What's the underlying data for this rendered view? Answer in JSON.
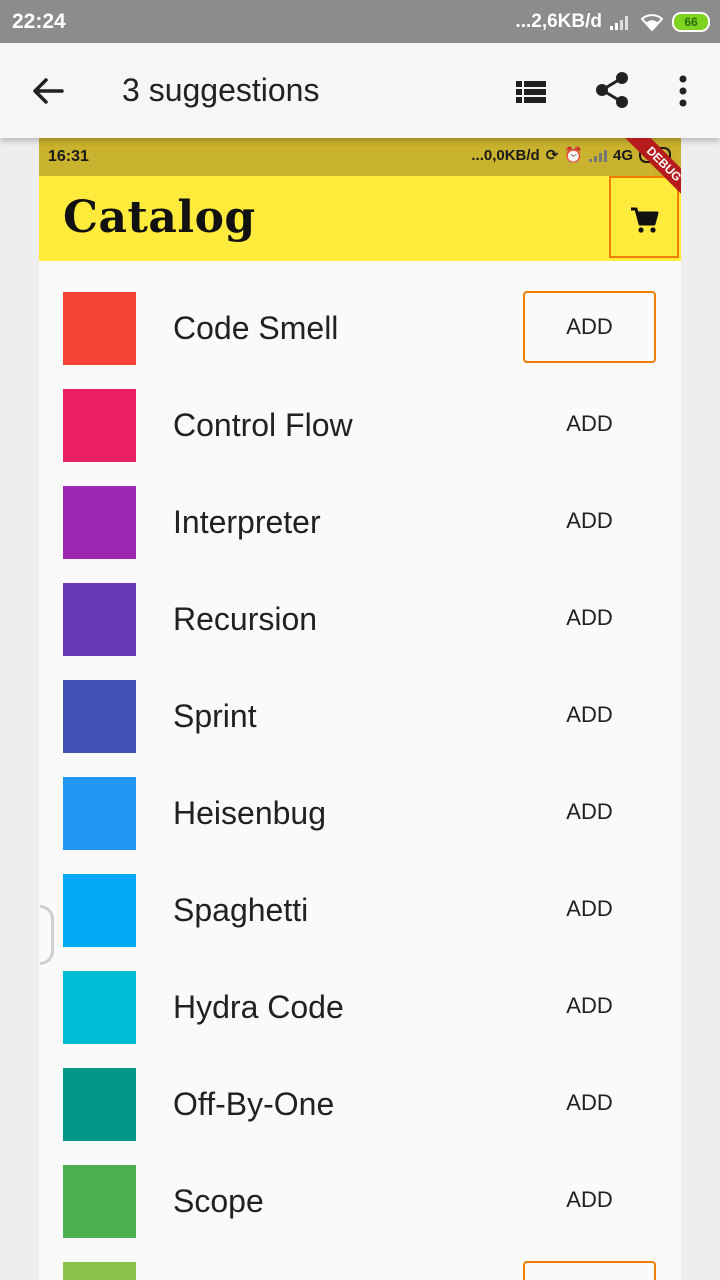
{
  "device_status": {
    "time": "22:24",
    "network": "...2,6KB/d",
    "battery": "66"
  },
  "appbar": {
    "title": "3 suggestions",
    "icons": [
      "back-arrow-icon",
      "list-view-icon",
      "share-icon",
      "more-vert-icon"
    ]
  },
  "app_status": {
    "time": "16:31",
    "network": "...0,0KB/d",
    "net_type": "4G",
    "battery": "69"
  },
  "catalog": {
    "title": "Catalog",
    "debug_banner": "DEBUG",
    "add_label": "ADD",
    "items": [
      {
        "name": "Code Smell",
        "color": "#f44336"
      },
      {
        "name": "Control Flow",
        "color": "#e91e63"
      },
      {
        "name": "Interpreter",
        "color": "#9c27b0"
      },
      {
        "name": "Recursion",
        "color": "#673ab7"
      },
      {
        "name": "Sprint",
        "color": "#3f51b5"
      },
      {
        "name": "Heisenbug",
        "color": "#2196f3"
      },
      {
        "name": "Spaghetti",
        "color": "#03a9f4"
      },
      {
        "name": "Hydra Code",
        "color": "#00bcd4"
      },
      {
        "name": "Off-By-One",
        "color": "#009688"
      },
      {
        "name": "Scope",
        "color": "#4caf50"
      },
      {
        "name": "",
        "color": "#8bc34a"
      }
    ]
  },
  "colors": {
    "highlight": "#ef7d00",
    "catalog_bar": "#ffeb3b",
    "inner_status": "#c9b22d"
  }
}
